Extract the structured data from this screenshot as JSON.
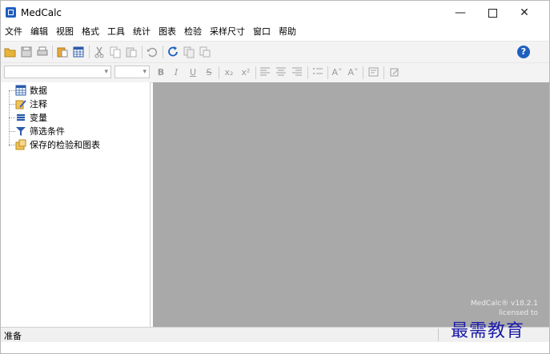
{
  "window": {
    "title": "MedCalc"
  },
  "menu": [
    "文件",
    "编辑",
    "视图",
    "格式",
    "工具",
    "统计",
    "图表",
    "检验",
    "采样尺寸",
    "窗口",
    "帮助"
  ],
  "toolbar": {
    "icons": [
      "open-icon",
      "save-icon",
      "print-icon",
      "paste-special-icon",
      "spreadsheet-icon",
      "cut-icon",
      "copy-icon",
      "paste-icon",
      "undo-icon",
      "refresh-icon",
      "copy-graph-icon",
      "copy-table-icon"
    ],
    "help_icon": "?"
  },
  "format_bar": {
    "bold": "B",
    "italic": "I",
    "underline": "U",
    "strike": "S",
    "subscript": "x₂",
    "superscript": "x²",
    "grow_font": "A˄",
    "shrink_font": "A˅"
  },
  "tree": [
    "数据",
    "注释",
    "变量",
    "筛选条件",
    "保存的检验和图表"
  ],
  "workspace": {
    "version": "MedCalc® v18.2.1",
    "licensed": "licensed to"
  },
  "status": {
    "text": "准备"
  },
  "watermark": "最需教育",
  "colors": {
    "accent": "#1f5fbf",
    "workspace_bg": "#a9a9a9",
    "watermark": "#1a1aa8"
  }
}
